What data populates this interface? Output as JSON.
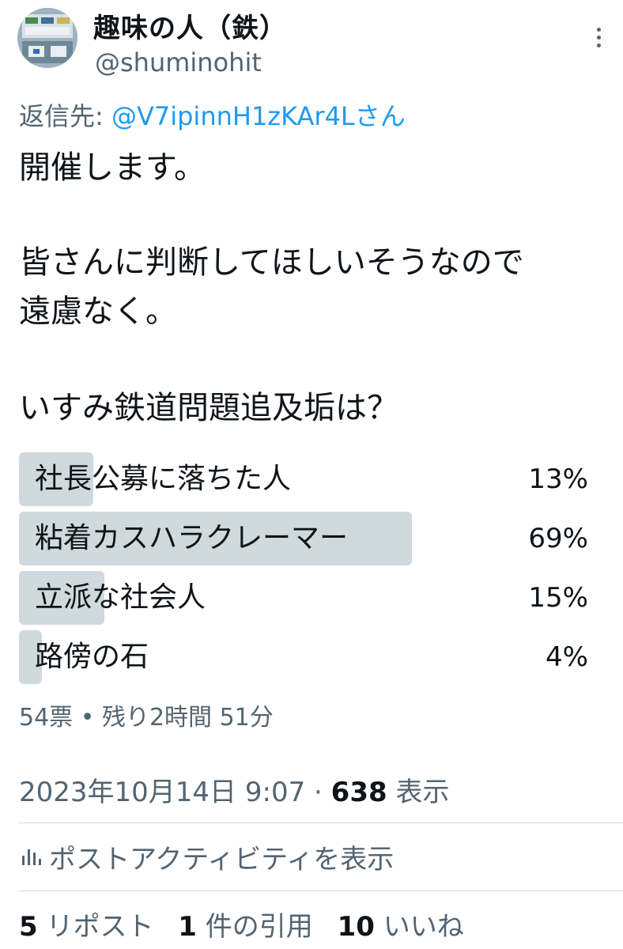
{
  "author": {
    "display_name": "趣味の人（鉄）",
    "handle": "@shuminohit"
  },
  "reply": {
    "prefix": "返信先:",
    "mention": "@V7ipinnH1zKAr4Lさん"
  },
  "tweet": {
    "lines": [
      "開催します。",
      "皆さんに判断してほしいそうなので",
      "遠慮なく。",
      "いすみ鉄道問題追及垢は？"
    ]
  },
  "poll": {
    "options": [
      {
        "label": "社長公募に落ちた人",
        "percent_text": "13%",
        "percent": 13
      },
      {
        "label": "粘着カスハラクレーマー",
        "percent_text": "69%",
        "percent": 69
      },
      {
        "label": "立派な社会人",
        "percent_text": "15%",
        "percent": 15
      },
      {
        "label": "路傍の石",
        "percent_text": "4%",
        "percent": 4
      }
    ],
    "meta": "54票 • 残り2時間 51分"
  },
  "timestamp": {
    "datetime": "2023年10月14日 9:07",
    "separator": "·",
    "views_count": "638",
    "views_label": "表示"
  },
  "activity": {
    "icon": "analytics-icon",
    "label": "ポストアクティビティを表示"
  },
  "stats": {
    "reposts_count": "5",
    "reposts_label": "リポスト",
    "quotes_count": "1",
    "quotes_label": "件の引用",
    "likes_count": "10",
    "likes_label": "いいね"
  },
  "colors": {
    "text": "#0f1419",
    "secondary": "#536471",
    "link": "#1d9bf0",
    "poll_bar": "#cfd9de"
  }
}
